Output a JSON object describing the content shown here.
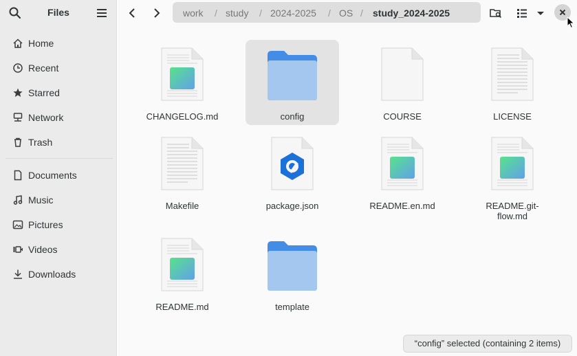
{
  "sidebar": {
    "title": "Files",
    "places": [
      {
        "label": "Home",
        "icon": "home-icon"
      },
      {
        "label": "Recent",
        "icon": "clock-icon"
      },
      {
        "label": "Starred",
        "icon": "star-icon"
      },
      {
        "label": "Network",
        "icon": "network-icon"
      },
      {
        "label": "Trash",
        "icon": "trash-icon"
      }
    ],
    "bookmarks": [
      {
        "label": "Documents",
        "icon": "document-icon"
      },
      {
        "label": "Music",
        "icon": "music-icon"
      },
      {
        "label": "Pictures",
        "icon": "picture-icon"
      },
      {
        "label": "Videos",
        "icon": "video-icon"
      },
      {
        "label": "Downloads",
        "icon": "download-icon"
      }
    ]
  },
  "path": {
    "segments": [
      "work",
      "study",
      "2024-2025",
      "OS",
      "study_2024-2025"
    ],
    "separator": "/"
  },
  "files": [
    {
      "name": "CHANGELOG.md",
      "type": "markdown"
    },
    {
      "name": "config",
      "type": "folder",
      "selected": true
    },
    {
      "name": "COURSE",
      "type": "blank"
    },
    {
      "name": "LICENSE",
      "type": "text"
    },
    {
      "name": "Makefile",
      "type": "text"
    },
    {
      "name": "package.json",
      "type": "json"
    },
    {
      "name": "README.en.md",
      "type": "markdown"
    },
    {
      "name": "README.git-flow.md",
      "type": "markdown"
    },
    {
      "name": "README.md",
      "type": "markdown"
    },
    {
      "name": "template",
      "type": "folder"
    }
  ],
  "status": {
    "text": "“config” selected  (containing 2 items)"
  },
  "colors": {
    "sidebar_bg": "#ebebeb",
    "folder_blue": "#438de6",
    "folder_light": "#a4c7f0",
    "selection": "#e3e3e3"
  }
}
